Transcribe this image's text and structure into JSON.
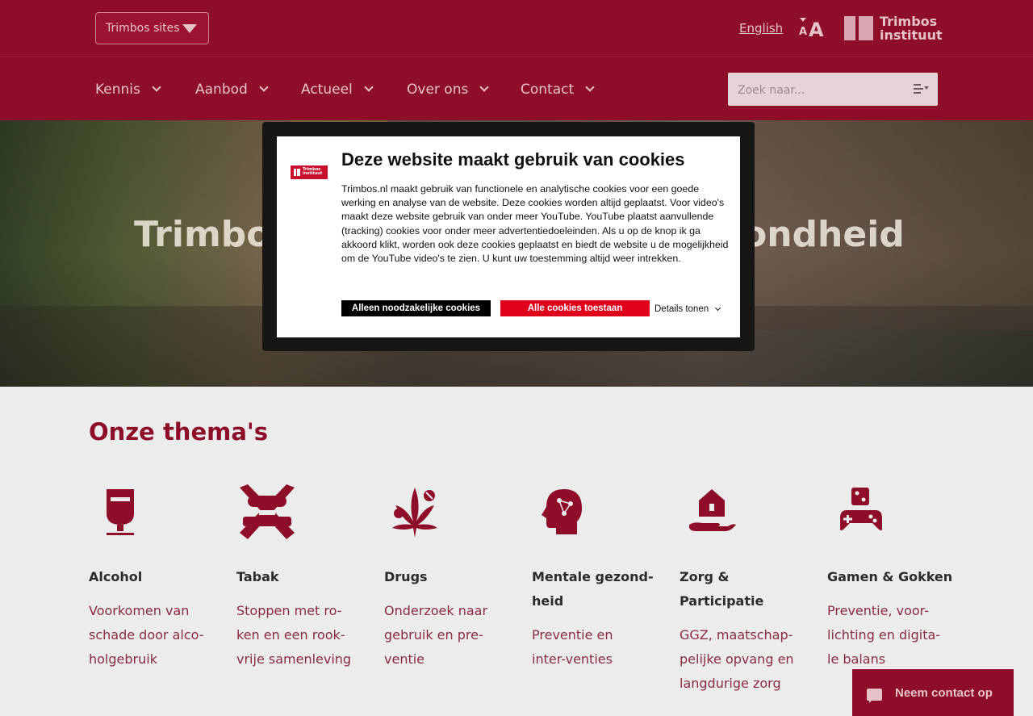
{
  "header": {
    "sites_label": "Trimbos sites",
    "language_link": "English",
    "font_size_small": "A",
    "font_size_large": "A",
    "logo_line1": "Trimbos",
    "logo_line2": "instituut"
  },
  "nav": {
    "items": [
      {
        "label": "Kennis"
      },
      {
        "label": "Aanbod"
      },
      {
        "label": "Actueel"
      },
      {
        "label": "Over ons"
      },
      {
        "label": "Contact"
      }
    ],
    "search_placeholder": "Zoek naar..."
  },
  "hero": {
    "title_left": "Trimbos",
    "title_right": "ondheid"
  },
  "cookie_dialog": {
    "logo_text": "Trimbos instituut",
    "title": "Deze website maakt gebruik van cookies",
    "body": "Trimbos.nl maakt gebruik van functionele en analytische cookies voor een goede werking en analyse van de website. Deze cookies worden altijd geplaatst. Voor video's maakt deze website gebruik van onder meer YouTube. YouTube plaatst aanvullende (tracking) cookies voor onder meer advertentiedoeleinden. Als u op de knop ik ga akkoord klikt, worden ook deze cookies geplaatst en biedt de website u de mogelijkheid om de YouTube video's te zien. U kunt uw toestemming altijd weer intrekken.",
    "btn_necessary": "Alleen noodzakelijke cookies",
    "btn_all": "Alle cookies toestaan",
    "details": "Details tonen"
  },
  "themes": {
    "title": "Onze thema's",
    "items": [
      {
        "name": "Alcohol",
        "desc": "Voorkomen van schade door alco-holgebruik",
        "icon": "wine-glass-icon"
      },
      {
        "name": "Tabak",
        "desc": "Stoppen met ro-ken en een rook-vrije samenleving",
        "icon": "no-smoking-icon"
      },
      {
        "name": "Drugs",
        "desc": "Onderzoek naar gebruik en pre-ventie",
        "icon": "cannabis-pills-icon"
      },
      {
        "name": "Mentale gezond-heid",
        "desc": "Preventie en inter-venties",
        "icon": "head-network-icon"
      },
      {
        "name": "Zorg & Participatie",
        "desc": "GGZ, maatschap-pelijke opvang en langdurige zorg",
        "icon": "hand-house-icon"
      },
      {
        "name": "Gamen & Gokken",
        "desc": "Preventie, voor-lichting en digita-le balans",
        "icon": "gamepad-dice-icon"
      }
    ]
  },
  "contact_button": "Neem contact op",
  "colors": {
    "brand": "#8e0e2a",
    "accent_red": "#e0001b"
  }
}
